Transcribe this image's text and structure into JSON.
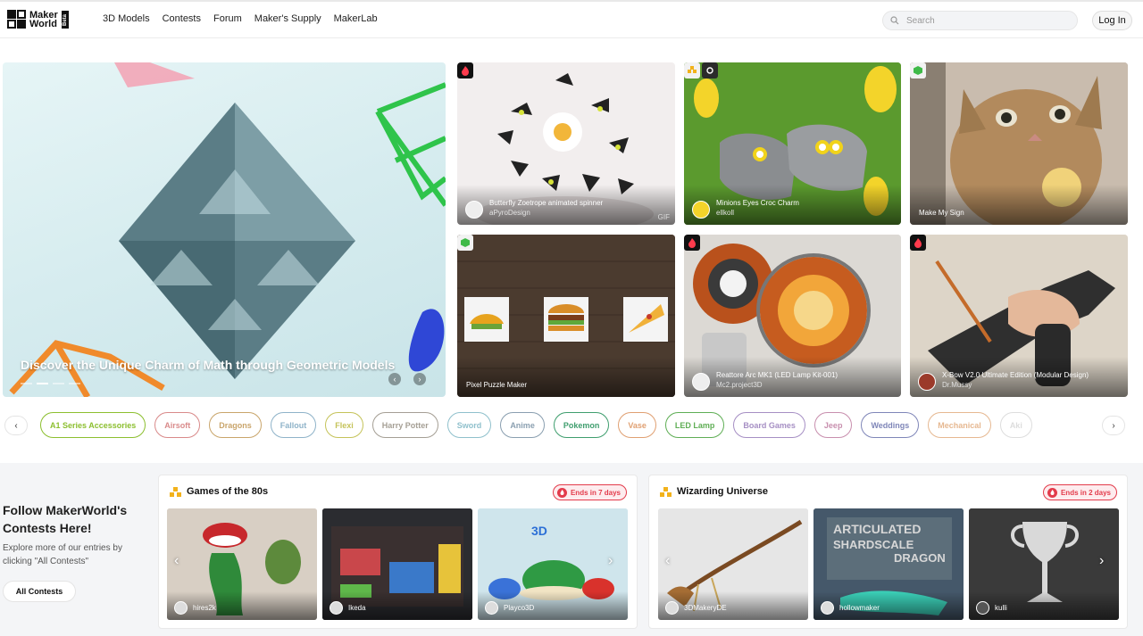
{
  "header": {
    "logo_text_1": "Maker",
    "logo_text_2": "World",
    "logo_badge": "Beta",
    "nav": [
      "3D Models",
      "Contests",
      "Forum",
      "Maker's Supply",
      "MakerLab"
    ],
    "search_placeholder": "Search",
    "login_label": "Log In"
  },
  "hero": {
    "title": "Discover the Unique Charm of Math through Geometric Models"
  },
  "cards": [
    {
      "title": "Butterfly Zoetrope animated spinner",
      "author": "aPyroDesign",
      "badge": "fire-icon",
      "gif": "GIF"
    },
    {
      "title": "Minions Eyes Croc Charm",
      "author": "ellkoll",
      "badge": "cube-icon"
    },
    {
      "title": "Make My Sign",
      "author": "",
      "badge": "cube-icon"
    },
    {
      "title": "Pixel Puzzle Maker",
      "author": "",
      "badge": "cube-icon"
    },
    {
      "title": "Reattore Arc MK1 (LED Lamp Kit-001)",
      "author": "Mc2.project3D",
      "badge": "fire-icon"
    },
    {
      "title": "X-Bow V2.0 Ultimate Edition (Modular Design)",
      "author": "Dr.Mussy",
      "badge": "fire-icon"
    }
  ],
  "tags": [
    {
      "label": "A1 Series Accessories",
      "color": "#8cbf2f"
    },
    {
      "label": "Airsoft",
      "color": "#d98a8a"
    },
    {
      "label": "Dragons",
      "color": "#c9a56b"
    },
    {
      "label": "Fallout",
      "color": "#8fb3c9"
    },
    {
      "label": "Flexi",
      "color": "#c5c35a"
    },
    {
      "label": "Harry Potter",
      "color": "#a59f95"
    },
    {
      "label": "Sword",
      "color": "#8fc0cc"
    },
    {
      "label": "Anime",
      "color": "#8a9fb0"
    },
    {
      "label": "Pokemon",
      "color": "#3f9e6e"
    },
    {
      "label": "Vase",
      "color": "#e0a072"
    },
    {
      "label": "LED Lamp",
      "color": "#5fae55"
    },
    {
      "label": "Board Games",
      "color": "#a68fc4"
    },
    {
      "label": "Jeep",
      "color": "#c88fae"
    },
    {
      "label": "Weddings",
      "color": "#7f86b8"
    },
    {
      "label": "Mechanical",
      "color": "#e6b891"
    },
    {
      "label": "Aki",
      "color": "#dddddd"
    }
  ],
  "contests": {
    "title": "Follow MakerWorld's Contests Here!",
    "desc": "Explore more of our entries by clicking \"All Contests\"",
    "button": "All Contests",
    "items": [
      {
        "name": "Games of the 80s",
        "ends": "Ends in 7 days",
        "users": [
          "hires2k",
          "Ikeda",
          "Playco3D"
        ]
      },
      {
        "name": "Wizarding Universe",
        "ends": "Ends in 2 days",
        "users": [
          "3DMakeryDE",
          "hollowmaker",
          "kulli"
        ]
      }
    ]
  },
  "colors": {
    "accent": "#e33b4b",
    "text": "#222222"
  }
}
